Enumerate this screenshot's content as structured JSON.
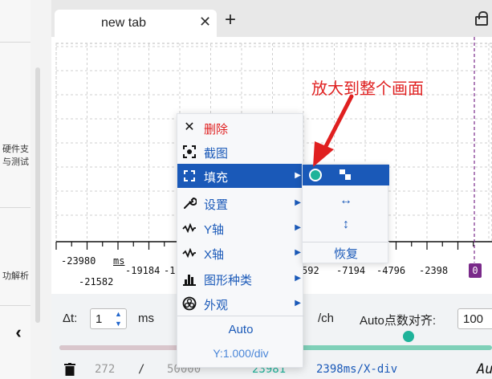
{
  "sidebar": {
    "item_a": "硬件支\n与测试",
    "item_b": "功解析",
    "collapse_icon": "chevron-left-icon"
  },
  "tabbar": {
    "tab_title": "new tab",
    "tab_close": "✕",
    "new_tab": "+"
  },
  "plot": {
    "x_ticks_row1": [
      "-23980",
      "ms",
      "-19184",
      "-1",
      "592",
      "-7194",
      "-4796",
      "-2398"
    ],
    "x_ticks_row2": [
      "-21582"
    ],
    "cursor_label": "0",
    "cursor_color": "#7a2a8a"
  },
  "context_menu": {
    "items": [
      {
        "label": "删除",
        "icon": "close-icon",
        "color": "#e02020"
      },
      {
        "label": "截图",
        "icon": "screenshot-icon"
      },
      {
        "label": "填充",
        "icon": "fill-frame-icon",
        "active": true,
        "submenu": true
      },
      {
        "label": "设置",
        "icon": "wrench-icon",
        "submenu": true
      },
      {
        "label": "Y轴",
        "icon": "waveform-icon",
        "submenu": true
      },
      {
        "label": "X轴",
        "icon": "waveform-icon",
        "submenu": true
      },
      {
        "label": "图形种类",
        "icon": "bar-chart-icon",
        "submenu": true
      },
      {
        "label": "外观",
        "icon": "palette-icon",
        "submenu": true
      }
    ],
    "auto_label": "Auto",
    "scale_label": "Y:1.000/div",
    "accent": "#1a59b8"
  },
  "submenu": {
    "horizontal": "↔",
    "vertical": "↕",
    "restore": "恢复"
  },
  "annotation": {
    "text": "放大到整个画面",
    "color": "#e02020"
  },
  "controls": {
    "dt_label": "Δt:",
    "dt_value": "1",
    "dt_unit": "ms",
    "ch_unit": "/ch",
    "align_label": "Auto点数对齐:",
    "align_value": "100",
    "status_a": "272",
    "status_sep": "/",
    "status_b": "50000",
    "status_c": "23981",
    "status_d": "2398ms/X-div",
    "status_e": "Au"
  }
}
